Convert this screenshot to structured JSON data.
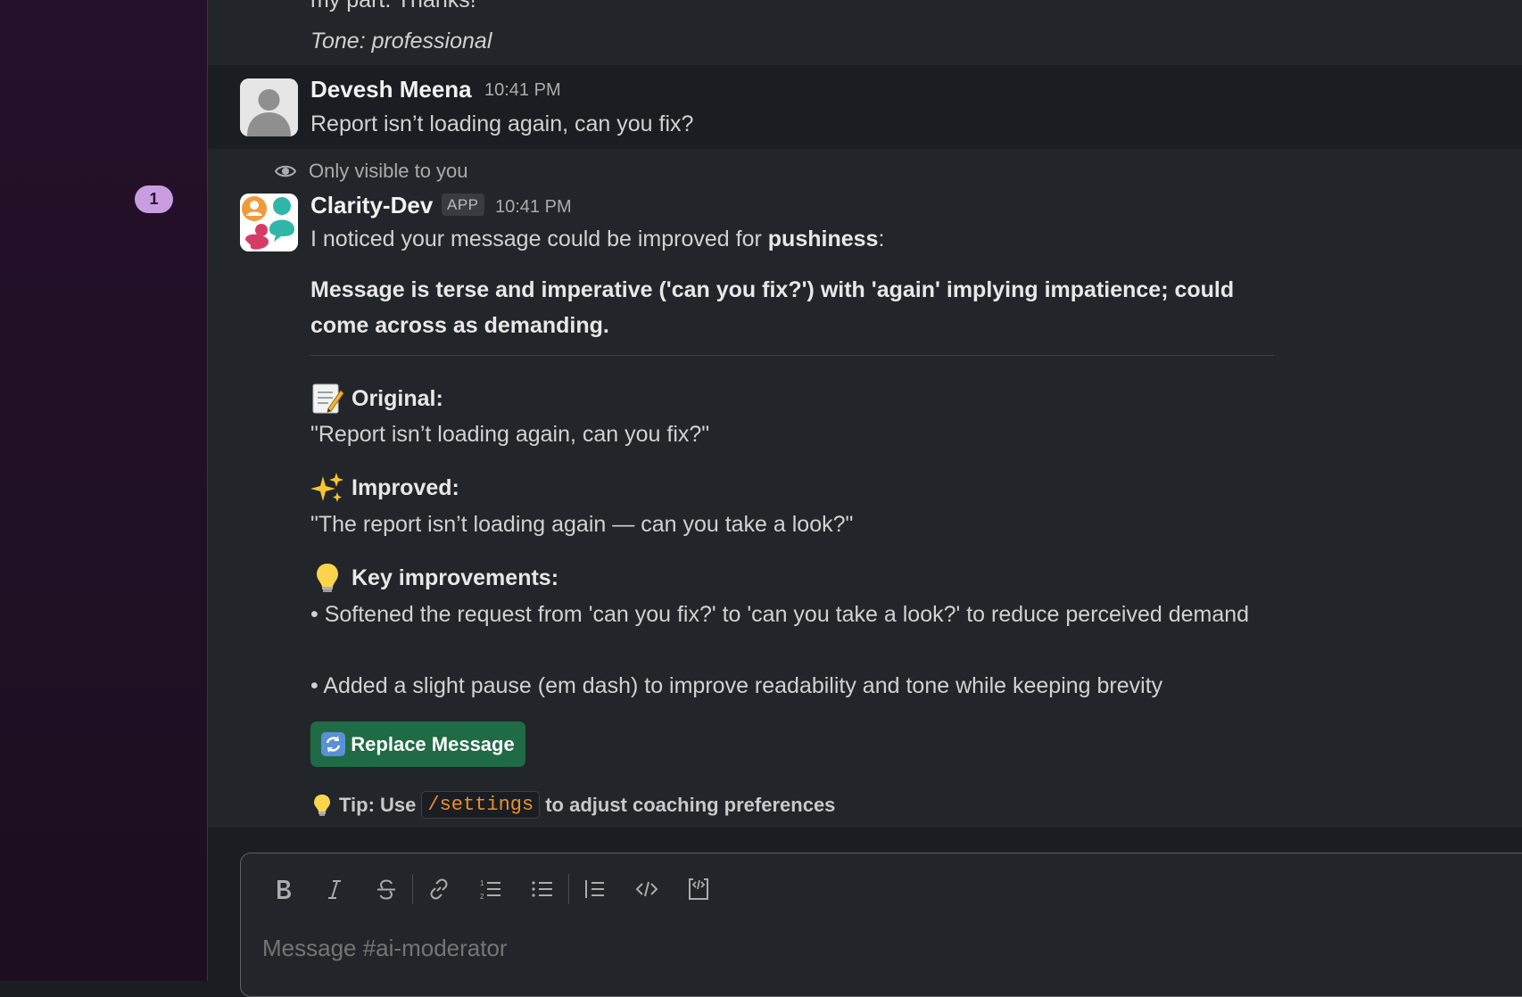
{
  "sidebar": {
    "unread_badge": "1"
  },
  "previous_message": {
    "partial_line": "my part. Thanks!",
    "tone": "Tone: professional"
  },
  "user_message": {
    "author": "Devesh Meena",
    "time": "10:41 PM",
    "text": "Report isn’t loading again, can you fix?"
  },
  "bot_message": {
    "visibility_note": "Only visible to you",
    "author": "Clarity-Dev",
    "app_tag": "APP",
    "time": "10:41 PM",
    "intro_prefix": "I noticed your message could be improved for ",
    "intro_bold": "pushiness",
    "intro_suffix": ":",
    "summary": "Message is terse and imperative ('can you fix?') with 'again' implying impatience; could come across as demanding.",
    "original_label": "Original:",
    "original_text": "\"Report isn’t loading again, can you fix?\"",
    "improved_label": "Improved:",
    "improved_text": "\"The report isn’t loading again — can you take a look?\"",
    "key_label": "Key improvements:",
    "bullets": [
      "• Softened the request from 'can you fix?' to 'can you take a look?' to reduce perceived demand",
      "• Added a slight pause (em dash) to improve readability and tone while keeping brevity"
    ],
    "replace_button": "Replace Message",
    "tip_prefix": "Tip: Use",
    "tip_code": "/settings",
    "tip_suffix": "to adjust coaching preferences"
  },
  "composer": {
    "placeholder": "Message #ai-moderator"
  },
  "colors": {
    "sidebar_bg": "#25112a",
    "main_bg": "#222529",
    "button_green": "#1f6b45",
    "badge": "#c99ee0",
    "code_orange": "#e8912d"
  }
}
